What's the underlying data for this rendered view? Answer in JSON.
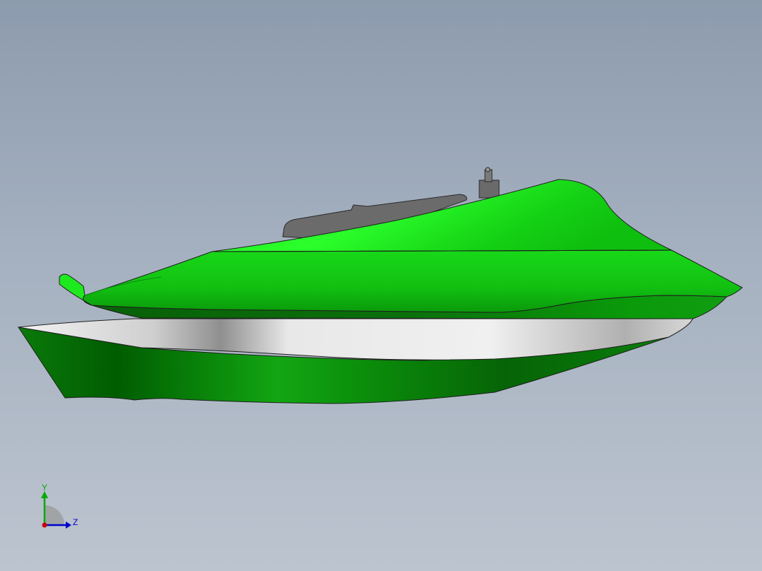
{
  "triad": {
    "y_label": "Y",
    "z_label": "Z",
    "x_color": "#cc0000",
    "y_color": "#00aa00",
    "z_color": "#0000cc"
  },
  "colors": {
    "background_top": "#8d9bae",
    "background_bottom": "#bcc4cf",
    "hull_green_light": "#22ff22",
    "hull_green_mid": "#12c812",
    "hull_green_dark": "#006e00",
    "hull_gray": "#e6e6e6",
    "part_gray": "#6e6e6e"
  }
}
